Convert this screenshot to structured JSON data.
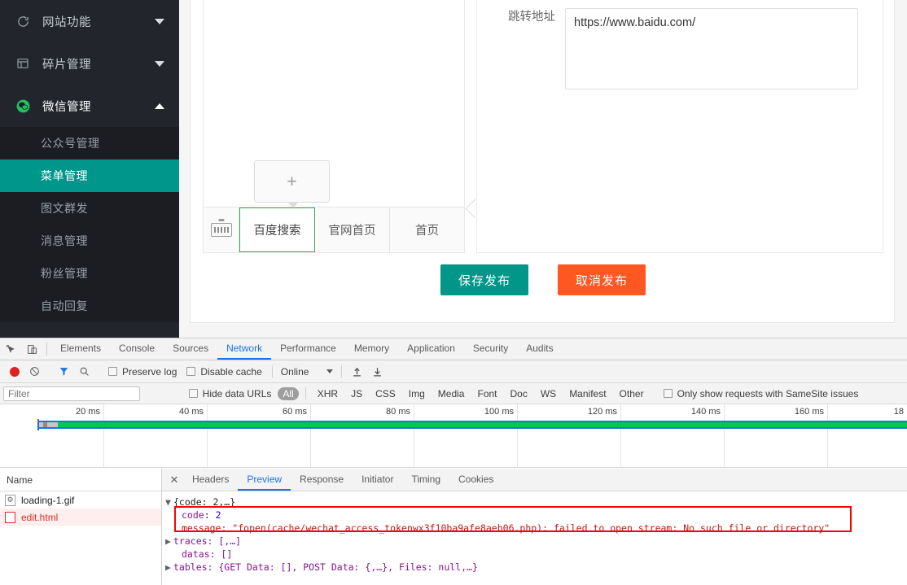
{
  "sidebar": {
    "groups": [
      {
        "label": "网站功能",
        "icon": "refresh-circle-icon",
        "expanded": false,
        "caret": "down"
      },
      {
        "label": "碎片管理",
        "icon": "window-panel-icon",
        "expanded": false,
        "caret": "down"
      },
      {
        "label": "微信管理",
        "icon": "wechat-icon",
        "expanded": true,
        "caret": "up"
      }
    ],
    "sub_items": [
      {
        "label": "公众号管理",
        "active": false
      },
      {
        "label": "菜单管理",
        "active": true
      },
      {
        "label": "图文群发",
        "active": false
      },
      {
        "label": "消息管理",
        "active": false
      },
      {
        "label": "粉丝管理",
        "active": false
      },
      {
        "label": "自动回复",
        "active": false
      }
    ],
    "active_color": "#00968b",
    "bg_color": "#22252b"
  },
  "menu_editor": {
    "add_button_label": "+",
    "keyboard_icon": "keyboard-icon",
    "menu_items": [
      {
        "label": "百度搜索",
        "selected": true
      },
      {
        "label": "官网首页",
        "selected": false
      },
      {
        "label": "首页",
        "selected": false
      }
    ],
    "form": {
      "url_label": "跳转地址",
      "url_value": "https://www.baidu.com/",
      "url_placeholder": ""
    },
    "spinner_icon": "loading-spinner-icon",
    "buttons": {
      "save_label": "保存发布",
      "save_color": "#009688",
      "cancel_label": "取消发布",
      "cancel_color": "#ff5722"
    }
  },
  "devtools": {
    "top_icons": [
      "inspect-element-icon",
      "device-toolbar-icon"
    ],
    "panels": [
      {
        "label": "Elements",
        "active": false
      },
      {
        "label": "Console",
        "active": false
      },
      {
        "label": "Sources",
        "active": false
      },
      {
        "label": "Network",
        "active": true
      },
      {
        "label": "Performance",
        "active": false
      },
      {
        "label": "Memory",
        "active": false
      },
      {
        "label": "Application",
        "active": false
      },
      {
        "label": "Security",
        "active": false
      },
      {
        "label": "Audits",
        "active": false
      }
    ],
    "toolbar": {
      "record_icon": "record-button-icon",
      "clear_icon": "clear-icon",
      "filter_icon": "filter-funnel-icon",
      "search_icon": "search-icon",
      "preserve_log_label": "Preserve log",
      "preserve_log_checked": false,
      "disable_cache_label": "Disable cache",
      "disable_cache_checked": false,
      "throttling_value": "Online",
      "import_icon": "import-har-icon",
      "export_icon": "export-har-icon"
    },
    "filterbar": {
      "filter_placeholder": "Filter",
      "filter_value": "",
      "hide_data_urls_label": "Hide data URLs",
      "hide_data_urls_checked": false,
      "types": [
        {
          "label": "All",
          "active": true
        },
        {
          "label": "XHR",
          "active": false
        },
        {
          "label": "JS",
          "active": false
        },
        {
          "label": "CSS",
          "active": false
        },
        {
          "label": "Img",
          "active": false
        },
        {
          "label": "Media",
          "active": false
        },
        {
          "label": "Font",
          "active": false
        },
        {
          "label": "Doc",
          "active": false
        },
        {
          "label": "WS",
          "active": false
        },
        {
          "label": "Manifest",
          "active": false
        },
        {
          "label": "Other",
          "active": false
        }
      ],
      "samesite_label": "Only show requests with SameSite issues",
      "samesite_checked": false
    },
    "overview": {
      "ticks": [
        "20 ms",
        "40 ms",
        "60 ms",
        "80 ms",
        "100 ms",
        "120 ms",
        "140 ms",
        "160 ms",
        "18"
      ],
      "band_color": "#00c853",
      "selection_color": "#1a73e8"
    },
    "requests": {
      "column_header": "Name",
      "rows": [
        {
          "name": "loading-1.gif",
          "icon": "image-file-icon",
          "error": false
        },
        {
          "name": "edit.html",
          "icon": "document-file-icon",
          "error": true
        }
      ]
    },
    "detail_tabs": [
      {
        "label": "Headers",
        "active": false
      },
      {
        "label": "Preview",
        "active": true
      },
      {
        "label": "Response",
        "active": false
      },
      {
        "label": "Initiator",
        "active": false
      },
      {
        "label": "Timing",
        "active": false
      },
      {
        "label": "Cookies",
        "active": false
      }
    ],
    "preview": {
      "root": "{code: 2,…}",
      "lines": [
        {
          "indent": 1,
          "text": "code: 2"
        },
        {
          "indent": 1,
          "text": "message: \"fopen(cache/wechat_access_tokenwx3f10ba9afe8aeb06.php): failed to open stream: No such file or directory\"",
          "highlight": true
        },
        {
          "indent": 1,
          "text": "traces: [,…]",
          "expandable": true
        },
        {
          "indent": 1,
          "text": "datas: []"
        },
        {
          "indent": 1,
          "text": "tables: {GET Data: [], POST Data: {,…}, Files: null,…}",
          "expandable": true
        }
      ],
      "highlight_color": "#ff0000"
    }
  }
}
